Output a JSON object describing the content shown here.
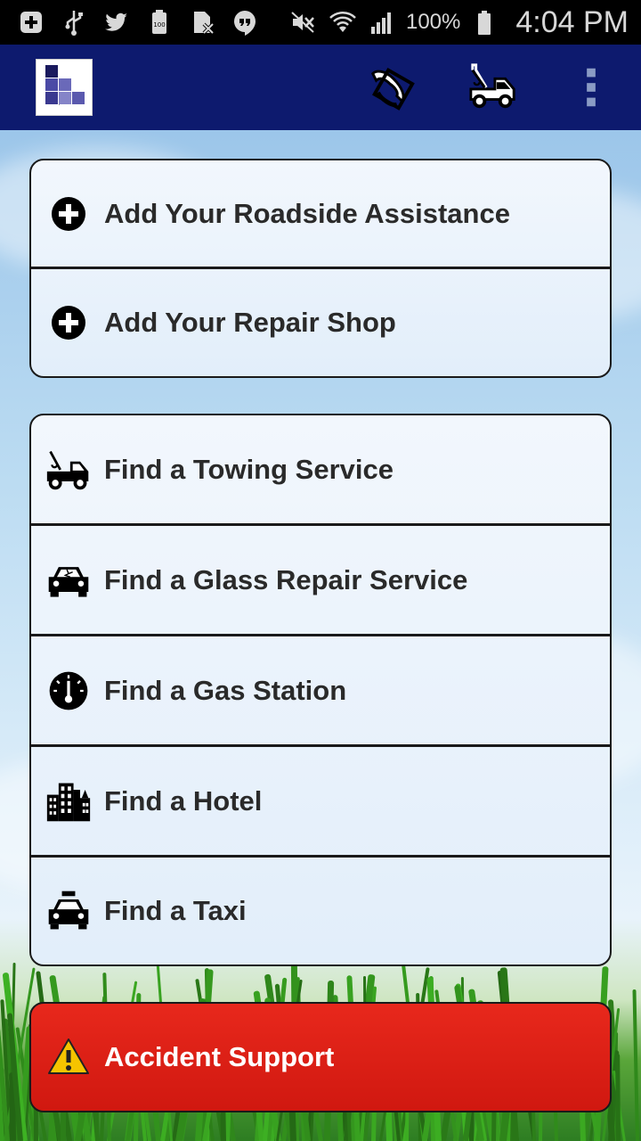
{
  "status_bar": {
    "battery": "100%",
    "time": "4:04 PM",
    "left_icons": [
      "plus-square-icon",
      "usb-icon",
      "twitter-icon",
      "battery-100-icon",
      "sim-blocked-icon",
      "hangouts-icon"
    ],
    "right_icons": [
      "mute-icon",
      "wifi-icon",
      "signal-icon"
    ]
  },
  "action_bar": {
    "logo_icon": "glass-atlas-logo",
    "actions": [
      "phone-swap-icon",
      "tow-truck-icon",
      "overflow-menu-icon"
    ]
  },
  "group1": [
    {
      "label": "Add Your Roadside Assistance",
      "icon": "plus-circle-icon"
    },
    {
      "label": "Add Your Repair Shop",
      "icon": "plus-circle-icon"
    }
  ],
  "group2": [
    {
      "label": "Find a Towing Service",
      "icon": "tow-truck-icon"
    },
    {
      "label": "Find a Glass Repair Service",
      "icon": "broken-glass-car-icon"
    },
    {
      "label": "Find a Gas Station",
      "icon": "fuel-gauge-icon"
    },
    {
      "label": "Find a Hotel",
      "icon": "buildings-icon"
    },
    {
      "label": "Find a Taxi",
      "icon": "taxi-icon"
    }
  ],
  "accident": {
    "label": "Accident Support",
    "icon": "warning-icon"
  },
  "colors": {
    "status_bar": "#000000",
    "action_bar": "#0d1a6e",
    "accident_red": "#d01810",
    "card_border": "#1a1a1a"
  }
}
